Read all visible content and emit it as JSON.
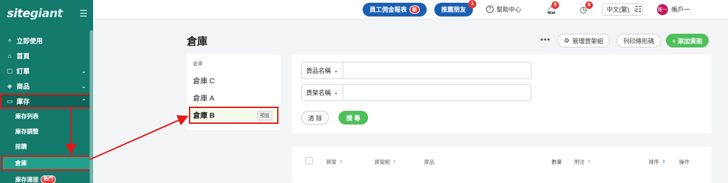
{
  "brand": {
    "logo_text_a": "site",
    "logo_text_b": "giant"
  },
  "sidebar": {
    "items": [
      {
        "label": "立即使用",
        "icon": "✧"
      },
      {
        "label": "首頁",
        "icon": "⌂"
      },
      {
        "label": "訂單",
        "icon": "▢",
        "chevron": "⌄"
      },
      {
        "label": "商品",
        "icon": "◈",
        "chevron": "⌄"
      },
      {
        "label": "庫存",
        "icon": "▭",
        "chevron": "⌃"
      }
    ],
    "subitems": [
      {
        "label": "庫存列表"
      },
      {
        "label": "庫存調整"
      },
      {
        "label": "採購"
      },
      {
        "label": "倉庫"
      },
      {
        "label": "庫存連接",
        "badge": "熱門"
      }
    ]
  },
  "topbar": {
    "commission_report": "員工佣金報表",
    "commission_badge": "新",
    "refer_friend": "推薦朋友",
    "refer_count": "1",
    "help": "幫助中心",
    "notif_count": "9",
    "timer_count": "6",
    "language": "中文(繁)",
    "avatar_text": "帳一",
    "account": "帳戶一"
  },
  "page": {
    "title": "倉庫",
    "more": "•••",
    "manage_btn": "管理貨架組",
    "print_btn": "列印條形碼",
    "add_btn": "+ 添加貨架"
  },
  "warehouses": {
    "header": "倉庫",
    "items": [
      {
        "name": "倉庫 C"
      },
      {
        "name": "倉庫 A"
      },
      {
        "name": "倉庫 B",
        "tag": "預設"
      }
    ]
  },
  "filters": {
    "product_name_label": "貨品名稱",
    "shelf_name_label": "貨架名稱",
    "clear": "清 除",
    "search": "搜 尋"
  },
  "table": {
    "columns": [
      "貨架",
      "貨架組",
      "貨品",
      "數量",
      "附注",
      "排序",
      "操作"
    ]
  }
}
